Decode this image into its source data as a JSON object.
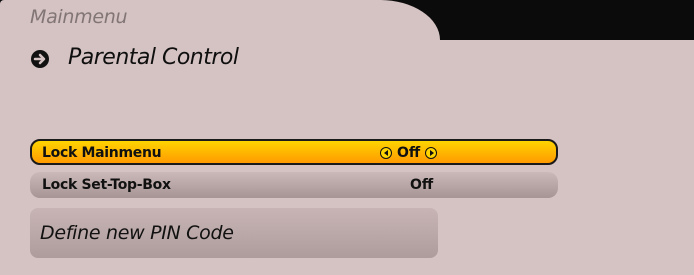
{
  "header": {
    "menu_label": "Mainmenu",
    "title": "Parental Control",
    "title_icon": "circle-arrow-right-icon"
  },
  "menu": {
    "rows": [
      {
        "label": "Lock Mainmenu",
        "value": "Off",
        "selected": true
      },
      {
        "label": "Lock Set-Top-Box",
        "value": "Off",
        "selected": false
      }
    ],
    "pin_button": "Define new PIN Code"
  },
  "colors": {
    "panel": "#d5c2c2",
    "highlight": "#ffbe00",
    "background": "#0a0a0a"
  }
}
